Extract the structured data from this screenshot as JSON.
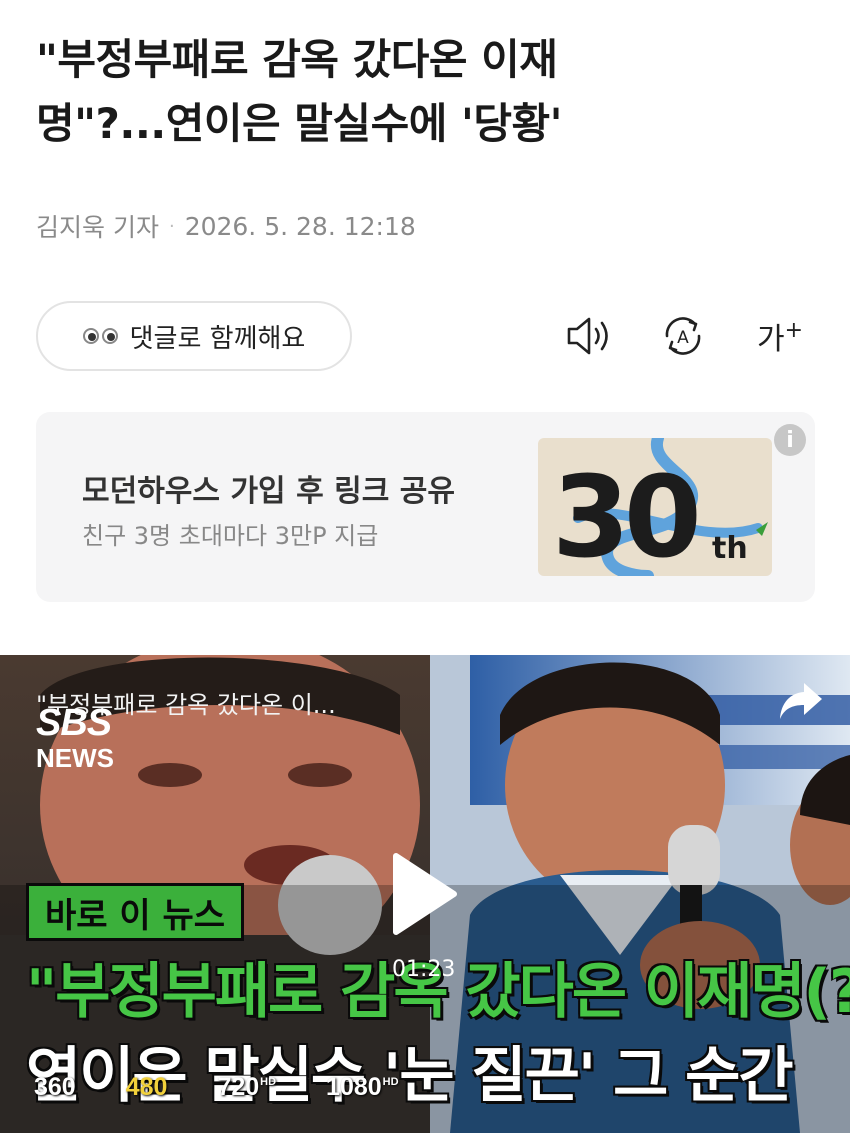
{
  "article": {
    "headline_line1": "\"부정부패로 감옥 갔다온 이재",
    "headline_line2": "명\"?...연이은 말실수에 '당황'",
    "author": "김지욱 기자",
    "date": "2026. 5. 28. 12:18"
  },
  "toolbar": {
    "comment_label": "댓글로 함께해요",
    "font_label": "가",
    "font_plus": "+"
  },
  "ad": {
    "title": "모던하우스 가입 후 링크 공유",
    "subtitle": "친구 3명 초대마다 3만P 지급",
    "image_text_number": "30",
    "image_text_suffix": "th",
    "info_icon": "i"
  },
  "video": {
    "title": "\"부정부패로 감옥 갔다온 이...",
    "logo_top": "SBS",
    "logo_bottom": "NEWS",
    "tag": "바로 이 뉴스",
    "caption_line1": "\"부정부패로 감옥 갔다온 이재명(?)\"",
    "caption_line2": "연이은 말실수 '눈 질끈' 그 순간",
    "timestamp": "01:23",
    "qualities": [
      {
        "label": "360",
        "hd": "",
        "active": false
      },
      {
        "label": "480",
        "hd": "",
        "active": true
      },
      {
        "label": "720",
        "hd": "HD",
        "active": false
      },
      {
        "label": "1080",
        "hd": "HD",
        "active": false
      }
    ]
  },
  "colors": {
    "accent_green": "#46c646",
    "active_quality": "#f2d13b",
    "ad_background": "#f5f5f6"
  }
}
